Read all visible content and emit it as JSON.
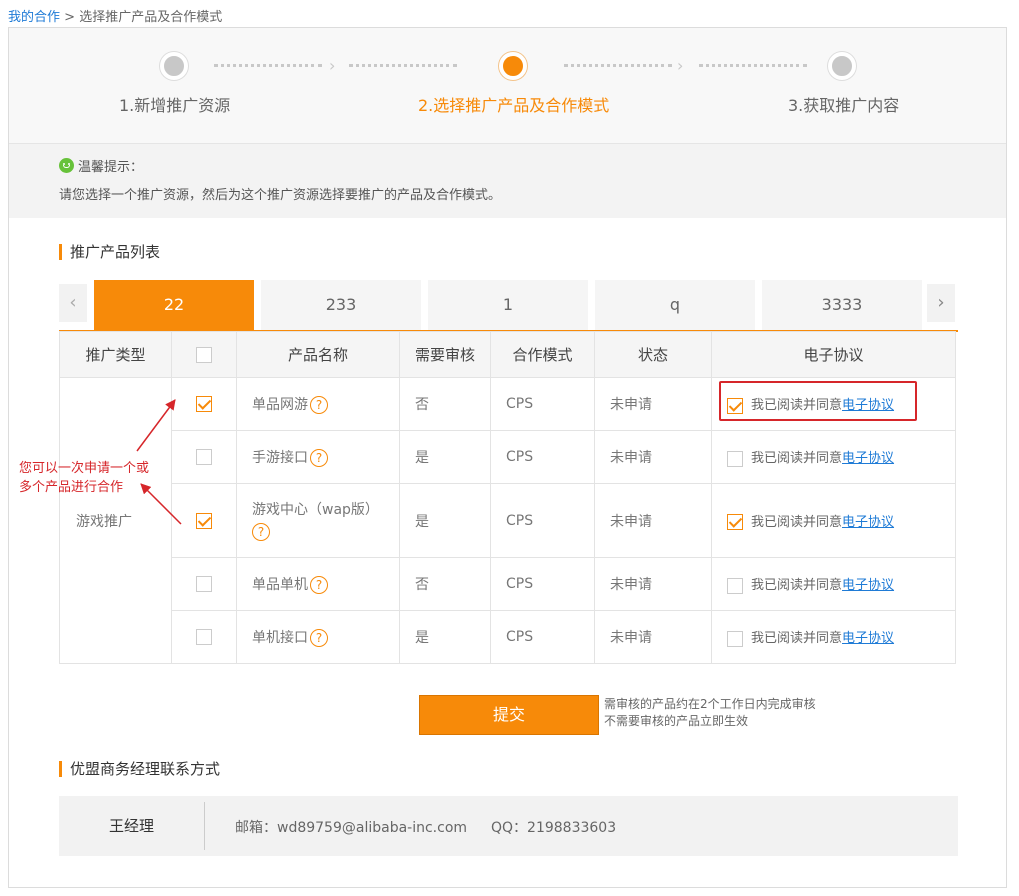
{
  "breadcrumb": {
    "root": "我的合作",
    "sep": ">",
    "current": "选择推广产品及合作模式"
  },
  "steps": [
    {
      "label": "1.新增推广资源",
      "state": "done"
    },
    {
      "label": "2.选择推广产品及合作模式",
      "state": "active"
    },
    {
      "label": "3.获取推广内容",
      "state": "pending"
    }
  ],
  "tip": {
    "title": "温馨提示：",
    "text": "请您选择一个推广资源，然后为这个推广资源选择要推广的产品及合作模式。"
  },
  "section1_title": "推广产品列表",
  "tabs": [
    "22",
    "233",
    "1",
    "q",
    "3333"
  ],
  "table": {
    "headers": [
      "推广类型",
      "",
      "产品名称",
      "需要审核",
      "合作模式",
      "状态",
      "电子协议"
    ],
    "category": "游戏推广",
    "agree_text": "我已阅读并同意",
    "agree_link": "电子协议",
    "rows": [
      {
        "name": "单品网游",
        "review": "否",
        "mode": "CPS",
        "status": "未申请",
        "checked": true,
        "agreed": true
      },
      {
        "name": "手游接口",
        "review": "是",
        "mode": "CPS",
        "status": "未申请",
        "checked": false,
        "agreed": false
      },
      {
        "name": "游戏中心（wap版）",
        "review": "是",
        "mode": "CPS",
        "status": "未申请",
        "checked": true,
        "agreed": true
      },
      {
        "name": "单品单机",
        "review": "否",
        "mode": "CPS",
        "status": "未申请",
        "checked": false,
        "agreed": false
      },
      {
        "name": "单机接口",
        "review": "是",
        "mode": "CPS",
        "status": "未申请",
        "checked": false,
        "agreed": false
      }
    ]
  },
  "annotation": {
    "line1": "您可以一次申请一个或",
    "line2": "多个产品进行合作"
  },
  "submit_label": "提交",
  "submit_note": {
    "line1": "需审核的产品约在2个工作日内完成审核",
    "line2": "不需要审核的产品立即生效"
  },
  "section2_title": "优盟商务经理联系方式",
  "contact": {
    "name": "王经理",
    "email": "邮箱：wd89759@alibaba-inc.com",
    "qq": "QQ：2198833603"
  },
  "colors": {
    "accent": "#f78a09",
    "annotation": "#d6262a",
    "link": "#1f7bd6"
  }
}
